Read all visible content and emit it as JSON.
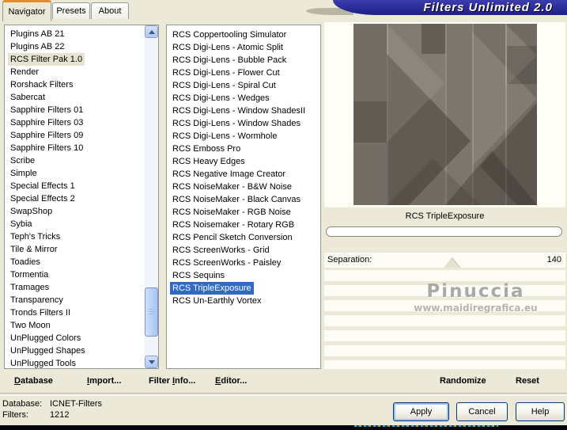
{
  "window": {
    "title": "Filters Unlimited 2.0"
  },
  "tabs": [
    {
      "label": "Navigator",
      "active": true
    },
    {
      "label": "Presets",
      "active": false
    },
    {
      "label": "About",
      "active": false
    }
  ],
  "navigator": {
    "items": [
      "Plugins AB 21",
      "Plugins AB 22",
      "RCS Filter Pak 1.0",
      "Render",
      "Rorshack Filters",
      "Sabercat",
      "Sapphire Filters 01",
      "Sapphire Filters 03",
      "Sapphire Filters 09",
      "Sapphire Filters 10",
      "Scribe",
      "Simple",
      "Special Effects 1",
      "Special Effects 2",
      "SwapShop",
      "Sybia",
      "Teph's Tricks",
      "Tile & Mirror",
      "Toadies",
      "Tormentia",
      "Tramages",
      "Transparency",
      "Tronds Filters II",
      "Two Moon",
      "UnPlugged Colors",
      "UnPlugged Shapes",
      "UnPlugged Tools"
    ],
    "selected_index": 2
  },
  "filters": {
    "items": [
      "RCS Coppertooling Simulator",
      "RCS Digi-Lens - Atomic Split",
      "RCS Digi-Lens - Bubble Pack",
      "RCS Digi-Lens - Flower Cut",
      "RCS Digi-Lens - Spiral Cut",
      "RCS Digi-Lens - Wedges",
      "RCS Digi-Lens - Window ShadesII",
      "RCS Digi-Lens - Window Shades",
      "RCS Digi-Lens - Wormhole",
      "RCS Emboss Pro",
      "RCS Heavy Edges",
      "RCS Negative Image Creator",
      "RCS NoiseMaker - B&W Noise",
      "RCS NoiseMaker - Black Canvas",
      "RCS NoiseMaker - RGB Noise",
      "RCS Noisemaker - Rotary RGB",
      "RCS Pencil Sketch Conversion",
      "RCS ScreenWorks - Grid",
      "RCS ScreenWorks - Paisley",
      "RCS Sequins",
      "RCS TripleExposure",
      "RCS Un-Earthly Vortex"
    ],
    "selected_index": 20
  },
  "preview": {
    "caption": "RCS TripleExposure"
  },
  "controls": {
    "separation_label": "Separation:",
    "separation_value": "140"
  },
  "actions": {
    "database": {
      "label": "Database",
      "u": 0
    },
    "import": {
      "label": "Import...",
      "u": 0
    },
    "filter_info": {
      "label": "Filter Info...",
      "u": 7
    },
    "editor": {
      "label": "Editor...",
      "u": 0
    },
    "randomize": {
      "label": "Randomize"
    },
    "reset": {
      "label": "Reset"
    }
  },
  "status": {
    "database_label": "Database:",
    "database_value": "ICNET-Filters",
    "filters_label": "Filters:",
    "filters_value": "1212"
  },
  "buttons": {
    "apply": "Apply",
    "cancel": "Cancel",
    "help": "Help"
  },
  "watermark": {
    "line1": "Pinuccia",
    "line2": "www.maidiregrafica.eu"
  },
  "colors": {
    "dialog_bg": "#ece9d8",
    "banner_blue": "#28289a",
    "selection_blue": "#316ac5",
    "tab_accent_orange": "#e68b2c"
  }
}
